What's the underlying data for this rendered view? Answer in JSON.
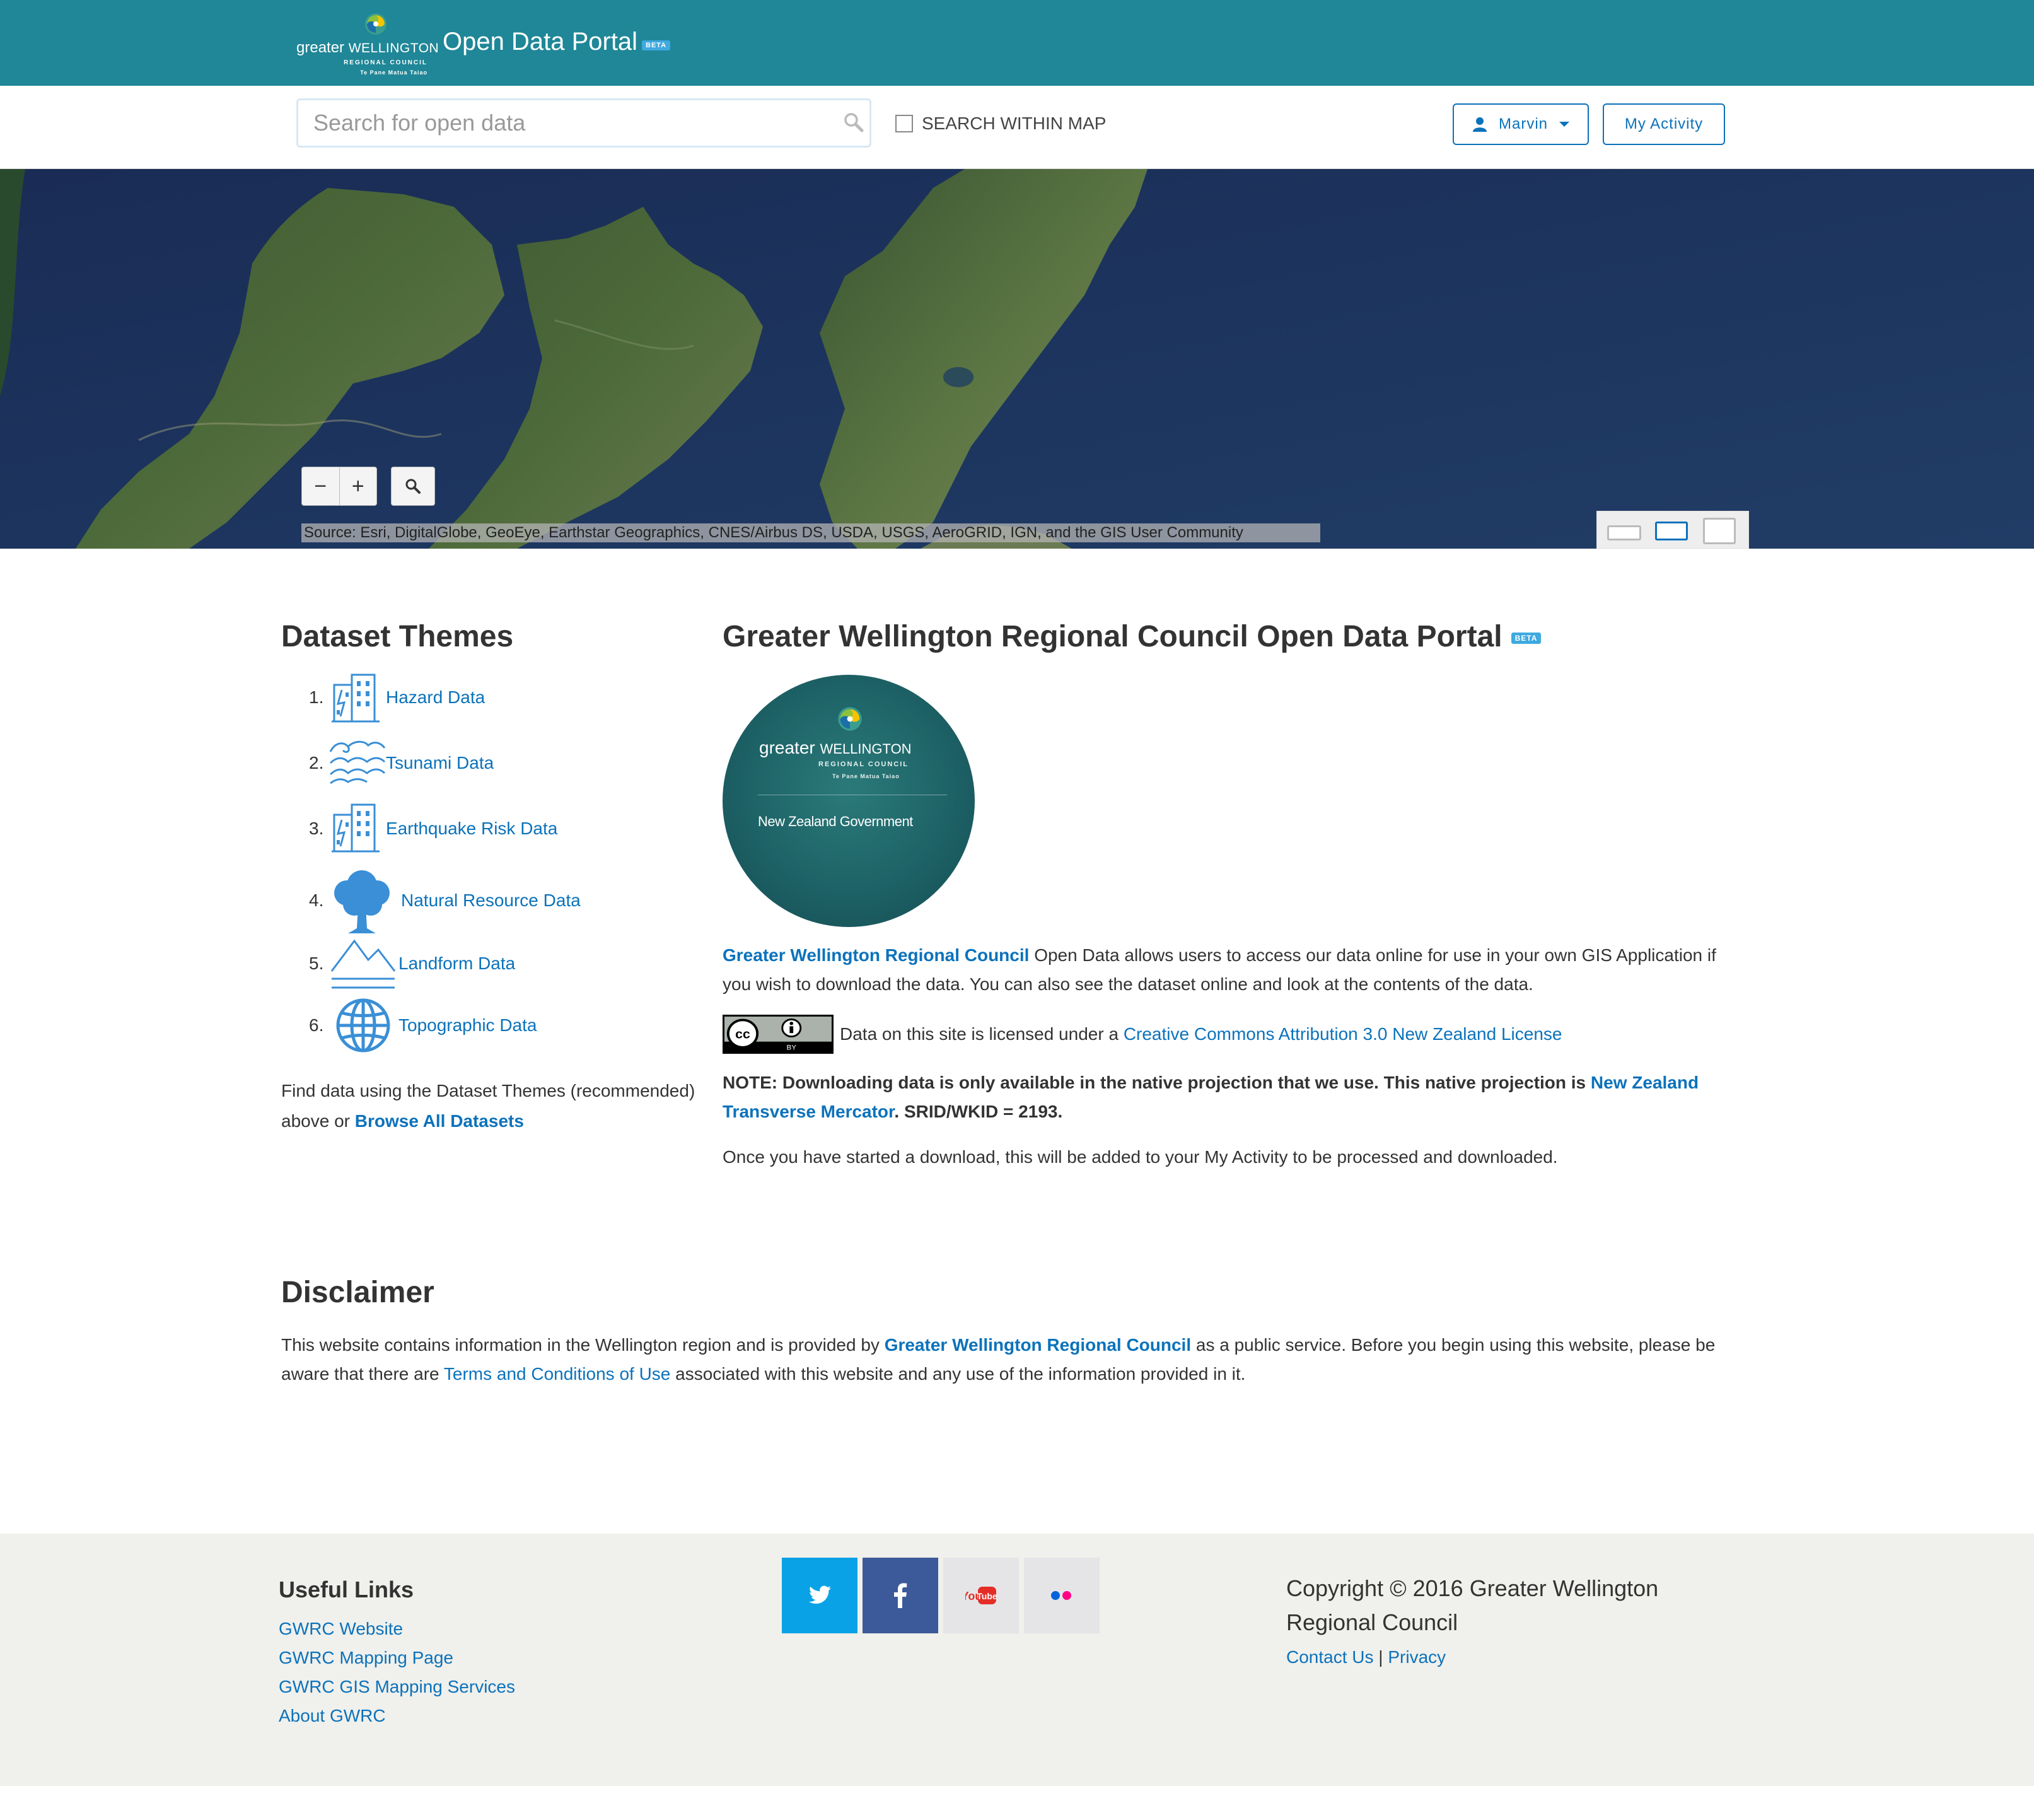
{
  "header": {
    "logo": {
      "line1_a": "greater",
      "line1_b": "WELLINGTON",
      "line2": "REGIONAL COUNCIL",
      "line3": "Te Pane Matua Taiao"
    },
    "title": "Open Data Portal",
    "beta_badge": "BETA",
    "brand_color": "#1f8797"
  },
  "searchbar": {
    "placeholder": "Search for open data",
    "search_within_map_label": "SEARCH WITHIN MAP",
    "search_within_map_checked": false,
    "user_button_label": "Marvin",
    "activity_button_label": "My Activity"
  },
  "map": {
    "zoom_out_label": "−",
    "zoom_in_label": "+",
    "attribution": "Source: Esri, DigitalGlobe, GeoEye, Earthstar Geographics, CNES/Airbus DS, USDA, USGS, AeroGRID, IGN, and the GIS User Community",
    "selected_layout": "map-layout-medium"
  },
  "themes": {
    "title": "Dataset Themes",
    "items": [
      {
        "num": "1.",
        "label": "Hazard Data",
        "icon": "buildings-icon"
      },
      {
        "num": "2.",
        "label": "Tsunami Data",
        "icon": "waves-icon"
      },
      {
        "num": "3.",
        "label": "Earthquake Risk Data",
        "icon": "buildings-icon"
      },
      {
        "num": "4.",
        "label": "Natural Resource Data",
        "icon": "tree-icon"
      },
      {
        "num": "5.",
        "label": "Landform Data",
        "icon": "mountains-icon"
      },
      {
        "num": "6.",
        "label": "Topographic Data",
        "icon": "globe-icon"
      }
    ],
    "find_text_a": "Find data using the Dataset Themes (recommended) above or ",
    "browse_all_label": "Browse All Datasets"
  },
  "main": {
    "title": "Greater Wellington Regional Council Open Data Portal",
    "beta_badge": "BETA",
    "emblem": {
      "line1_a": "greater",
      "line1_b": "WELLINGTON",
      "line2": "REGIONAL COUNCIL",
      "line3": "Te Pane Matua Taiao",
      "line4": "New Zealand Government"
    },
    "intro_link": "Greater Wellington Regional Council",
    "intro_text": " Open Data allows users to access our data online for use in your own GIS Application if you wish to download the data. You can also see the dataset online and look at the contents of the data.",
    "cc_badge_text": "BY",
    "license_text": "Data on this site is licensed under a ",
    "license_link": "Creative Commons Attribution 3.0 New Zealand License",
    "note_text": "NOTE: Downloading data is only available in the native projection that we use. This native projection is ",
    "note_link": "New Zealand Transverse Mercator",
    "note_suffix": ". SRID/WKID = 2193.",
    "once_text": "Once you have started a download, this will be added to your My Activity to be processed and downloaded."
  },
  "disclaimer": {
    "title": "Disclaimer",
    "text_a": "This website contains information in the Wellington region and is provided by ",
    "link_gwrc": "Greater Wellington Regional Council",
    "text_b": " as a public service. Before you begin using this website, please be aware that there are ",
    "link_terms": "Terms and Conditions of Use",
    "text_c": " associated with this website and any use of the information provided in it."
  },
  "footer": {
    "useful_title": "Useful Links",
    "useful_links": [
      "GWRC Website",
      "GWRC Mapping Page",
      "GWRC GIS Mapping Services",
      "About GWRC"
    ],
    "youtube_label": "You",
    "youtube_label_b": "Tube",
    "copyright": "Copyright © 2016 Greater Wellington Regional Council",
    "contact_label": "Contact Us",
    "separator": " | ",
    "privacy_label": "Privacy"
  },
  "colors": {
    "link": "#0b72bb",
    "beta": "#3fa9e0",
    "twitter": "#0aa2e6",
    "facebook": "#3c5a99",
    "footer_bg": "#f0f0ec"
  }
}
